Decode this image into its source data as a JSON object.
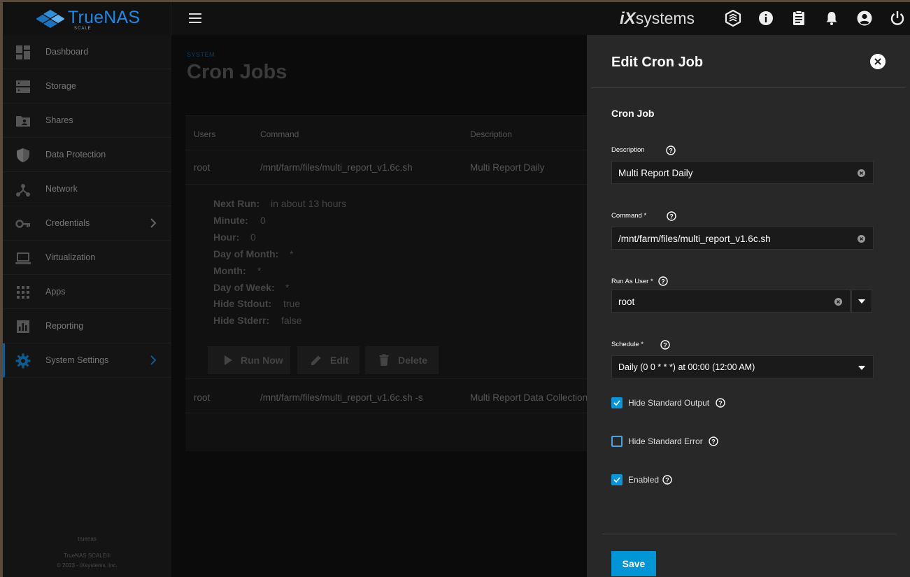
{
  "app": {
    "logo_text": "TrueNAS",
    "logo_sub": "SCALE",
    "vendor_ix": "iX",
    "vendor_systems": "systems"
  },
  "colors": {
    "accent": "#0095d5",
    "brand_blue": "#1e88e5",
    "panel_bg": "#282828"
  },
  "topbar": {
    "icons": [
      "menu-icon",
      "truecommand-icon",
      "info-icon",
      "clipboard-icon",
      "bell-icon",
      "account-icon",
      "power-icon"
    ]
  },
  "sidebar": {
    "items": [
      {
        "label": "Dashboard",
        "icon": "dashboard-icon"
      },
      {
        "label": "Storage",
        "icon": "storage-icon"
      },
      {
        "label": "Shares",
        "icon": "folder-user-icon"
      },
      {
        "label": "Data Protection",
        "icon": "shield-icon"
      },
      {
        "label": "Network",
        "icon": "network-icon"
      },
      {
        "label": "Credentials",
        "icon": "key-icon"
      },
      {
        "label": "Virtualization",
        "icon": "laptop-icon"
      },
      {
        "label": "Apps",
        "icon": "apps-grid-icon"
      },
      {
        "label": "Reporting",
        "icon": "chart-icon"
      },
      {
        "label": "System Settings",
        "icon": "gear-icon"
      }
    ],
    "footer_host": "truenas",
    "footer_product": "TrueNAS SCALE®",
    "footer_copyright": "© 2023 - iXsystems, Inc."
  },
  "main": {
    "breadcrumb": "SYSTEM",
    "title": "Cron Jobs",
    "table": {
      "headers": {
        "users": "Users",
        "command": "Command",
        "description": "Description"
      },
      "rows": [
        {
          "user": "root",
          "command": "/mnt/farm/files/multi_report_v1.6c.sh",
          "description": "Multi Report Daily"
        },
        {
          "user": "root",
          "command": "/mnt/farm/files/multi_report_v1.6c.sh -s",
          "description": "Multi Report Data Collection"
        }
      ]
    },
    "details": [
      {
        "key": "Next Run:",
        "value": "in about 13 hours"
      },
      {
        "key": "Minute:",
        "value": "0"
      },
      {
        "key": "Hour:",
        "value": "0"
      },
      {
        "key": "Day of Month:",
        "value": "*"
      },
      {
        "key": "Month:",
        "value": "*"
      },
      {
        "key": "Day of Week:",
        "value": "*"
      },
      {
        "key": "Hide Stdout:",
        "value": "true"
      },
      {
        "key": "Hide Stderr:",
        "value": "false"
      }
    ],
    "actions": {
      "run_now": "Run Now",
      "edit": "Edit",
      "delete": "Delete"
    }
  },
  "panel": {
    "title": "Edit Cron Job",
    "section": "Cron Job",
    "description": {
      "label": "Description",
      "value": "Multi Report Daily"
    },
    "command": {
      "label": "Command *",
      "value": "/mnt/farm/files/multi_report_v1.6c.sh"
    },
    "run_as_user": {
      "label": "Run As User *",
      "value": "root"
    },
    "schedule": {
      "label": "Schedule *",
      "value": "Daily (0 0 * * *) at 00:00 (12:00 AM)"
    },
    "hide_stdout": {
      "label": "Hide Standard Output",
      "checked": true
    },
    "hide_stderr": {
      "label": "Hide Standard Error",
      "checked": false
    },
    "enabled": {
      "label": "Enabled",
      "checked": true
    },
    "save_label": "Save"
  }
}
